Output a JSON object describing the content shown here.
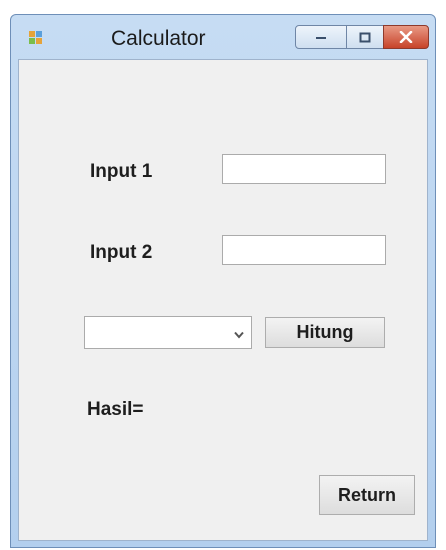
{
  "window": {
    "title": "Calculator",
    "controls": {
      "minimize": "minimize",
      "maximize": "maximize",
      "close": "close"
    }
  },
  "form": {
    "input1_label": "Input 1",
    "input1_value": "",
    "input2_label": "Input 2",
    "input2_value": "",
    "operation_selected": "",
    "hitung_label": "Hitung",
    "hasil_label": "Hasil=",
    "return_label": "Return"
  },
  "colors": {
    "titlebar": "#c6dcf3",
    "client_bg": "#f0f0f0",
    "close_button": "#c7432a"
  }
}
